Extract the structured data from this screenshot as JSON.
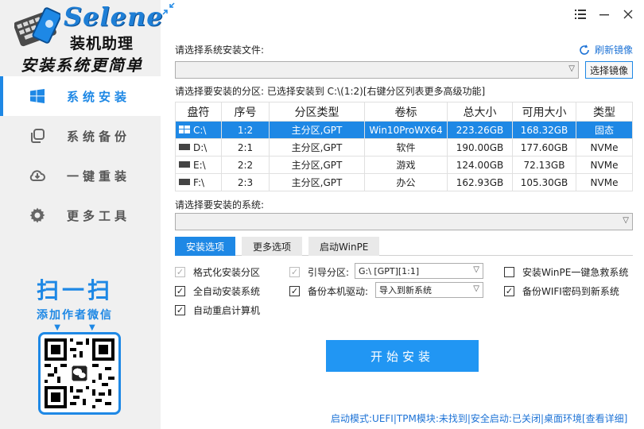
{
  "brand": {
    "name": "Selene",
    "subtitle": "装机助理",
    "slogan": "安装系统更简单"
  },
  "sidebar": {
    "items": [
      {
        "label": "系统安装",
        "icon": "windows-icon",
        "active": true
      },
      {
        "label": "系统备份",
        "icon": "copy-icon",
        "active": false
      },
      {
        "label": "一键重装",
        "icon": "cloud-icon",
        "active": false
      },
      {
        "label": "更多工具",
        "icon": "gear-icon",
        "active": false
      }
    ],
    "promo_title": "扫一扫",
    "promo_sub": "添加作者微信"
  },
  "file_section": {
    "label": "请选择系统安装文件:",
    "refresh_label": "刷新镜像",
    "file_value": "",
    "browse_label": "选择镜像"
  },
  "partition_section": {
    "label": "请选择要安装的分区: 已选择安装到 C:\\(1:2)[右键分区列表更多高级功能]",
    "columns": [
      "盘符",
      "序号",
      "分区类型",
      "卷标",
      "总大小",
      "可用大小",
      "类型"
    ],
    "rows": [
      {
        "drive": "C:\\",
        "index": "1:2",
        "ptype": "主分区,GPT",
        "volume": "Win10ProWX64",
        "total": "223.26GB",
        "free": "168.32GB",
        "media": "固态"
      },
      {
        "drive": "D:\\",
        "index": "2:1",
        "ptype": "主分区,GPT",
        "volume": "软件",
        "total": "190.00GB",
        "free": "177.60GB",
        "media": "NVMe"
      },
      {
        "drive": "E:\\",
        "index": "2:2",
        "ptype": "主分区,GPT",
        "volume": "游戏",
        "total": "124.00GB",
        "free": "72.13GB",
        "media": "NVMe"
      },
      {
        "drive": "F:\\",
        "index": "2:3",
        "ptype": "主分区,GPT",
        "volume": "办公",
        "total": "162.93GB",
        "free": "105.30GB",
        "media": "NVMe"
      }
    ]
  },
  "system_section": {
    "label": "请选择要安装的系统:",
    "value": ""
  },
  "tabs": [
    "安装选项",
    "更多选项",
    "启动WinPE"
  ],
  "options": {
    "format": "格式化安装分区",
    "auto_install": "全自动安装系统",
    "auto_restart": "自动重启计算机",
    "boot_partition": "引导分区:",
    "boot_value": "G:\\ [GPT][1:1]",
    "backup_driver": "备份本机驱动:",
    "backup_driver_value": "导入到新系统",
    "winpe_rescue": "安装WinPE一键急救系统",
    "backup_wifi": "备份WIFI密码到新系统"
  },
  "start_label": "开始安装",
  "status": {
    "text": "启动模式:UEFI|TPM模块:未找到|安全启动:已关闭|桌面环境",
    "link": "[查看详细]"
  },
  "colors": {
    "accent": "#1e88e5",
    "sidebar_bg": "#f0f0f0"
  }
}
